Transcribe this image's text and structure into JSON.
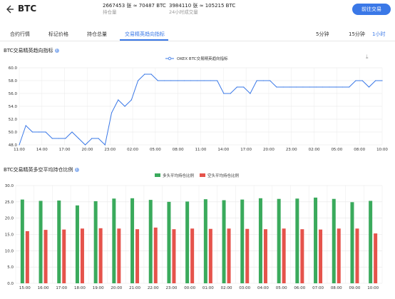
{
  "header": {
    "back_icon": "back-arrow-icon",
    "symbol": "BTC",
    "open_interest_value": "2667453 张 ≈ 70487 BTC",
    "open_interest_label": "持仓量",
    "volume_value": "3984110 张 ≈ 105215 BTC",
    "volume_label": "24小时成交量",
    "trade_button": "前往交易"
  },
  "tabs": [
    {
      "label": "合约行情",
      "active": false
    },
    {
      "label": "标记价格",
      "active": false
    },
    {
      "label": "持仓总量",
      "active": false
    },
    {
      "label": "交易精英趋向指标",
      "active": true
    }
  ],
  "periods": [
    {
      "label": "5分钟",
      "active": false
    },
    {
      "label": "15分钟",
      "active": false
    },
    {
      "label": "1小时",
      "active": true
    }
  ],
  "colors": {
    "accent": "#3a78e7",
    "long": "#3aaa5c",
    "short": "#e5534b",
    "grid": "#e6e6e6"
  },
  "chart_data": [
    {
      "type": "line",
      "title": "BTC交易精英趋向指标",
      "legend": [
        "OKEX BTC交易精英趋向指标"
      ],
      "legend_position": "top-center",
      "grid": true,
      "ylim": [
        48.0,
        60.0
      ],
      "yticks": [
        "60.0",
        "58.0",
        "56.0",
        "54.0",
        "52.0",
        "50.0",
        "48.0"
      ],
      "xticks": [
        "11:00",
        "14:00",
        "17:00",
        "20:00",
        "23:00",
        "02:00",
        "05:00",
        "08:00",
        "11:00",
        "14:00",
        "17:00",
        "20:00",
        "23:00",
        "02:00",
        "05:00",
        "08:00",
        "10:00"
      ],
      "series": [
        {
          "name": "OKEX BTC交易精英趋向指标",
          "values": [
            48,
            51,
            50,
            50,
            50,
            49,
            49,
            49,
            50,
            49,
            48,
            49,
            49,
            48,
            53,
            55,
            54,
            55,
            58,
            59,
            59,
            58,
            58,
            58,
            58,
            58,
            58,
            58,
            58,
            58,
            58,
            56,
            56,
            57,
            57,
            56,
            58,
            58,
            58,
            57,
            57,
            57,
            57,
            57,
            57,
            57,
            57,
            57,
            57,
            57,
            57,
            58,
            58,
            57,
            58,
            58
          ]
        }
      ]
    },
    {
      "type": "bar",
      "title": "BTC交易精英多空平均持仓比例",
      "legend": [
        "多头平均持仓比例",
        "空头平均持仓比例"
      ],
      "legend_position": "top-center",
      "grid": true,
      "ylim": [
        0,
        30
      ],
      "yticks": [
        "30.0",
        "25.0",
        "20.0",
        "15.0",
        "10.0",
        "5.0",
        "0.0"
      ],
      "categories": [
        "15:00",
        "16:00",
        "17:00",
        "18:00",
        "19:00",
        "20:00",
        "21:00",
        "22:00",
        "23:00",
        "00:00",
        "01:00",
        "02:00",
        "03:00",
        "04:00",
        "05:00",
        "06:00",
        "07:00",
        "08:00",
        "09:00",
        "10:00"
      ],
      "series": [
        {
          "name": "多头平均持仓比例",
          "values": [
            25.7,
            25.3,
            25.4,
            23.9,
            25.2,
            26.0,
            26.1,
            25.6,
            25.0,
            25.1,
            25.8,
            25.5,
            25.7,
            26.1,
            25.9,
            26.0,
            26.3,
            25.9,
            24.9,
            25.3
          ]
        },
        {
          "name": "空头平均持仓比例",
          "values": [
            16.0,
            16.4,
            16.5,
            16.8,
            16.9,
            16.8,
            16.6,
            17.1,
            16.6,
            16.8,
            16.7,
            16.8,
            16.7,
            16.6,
            16.8,
            16.6,
            16.5,
            16.8,
            16.8,
            15.3
          ]
        }
      ]
    }
  ]
}
